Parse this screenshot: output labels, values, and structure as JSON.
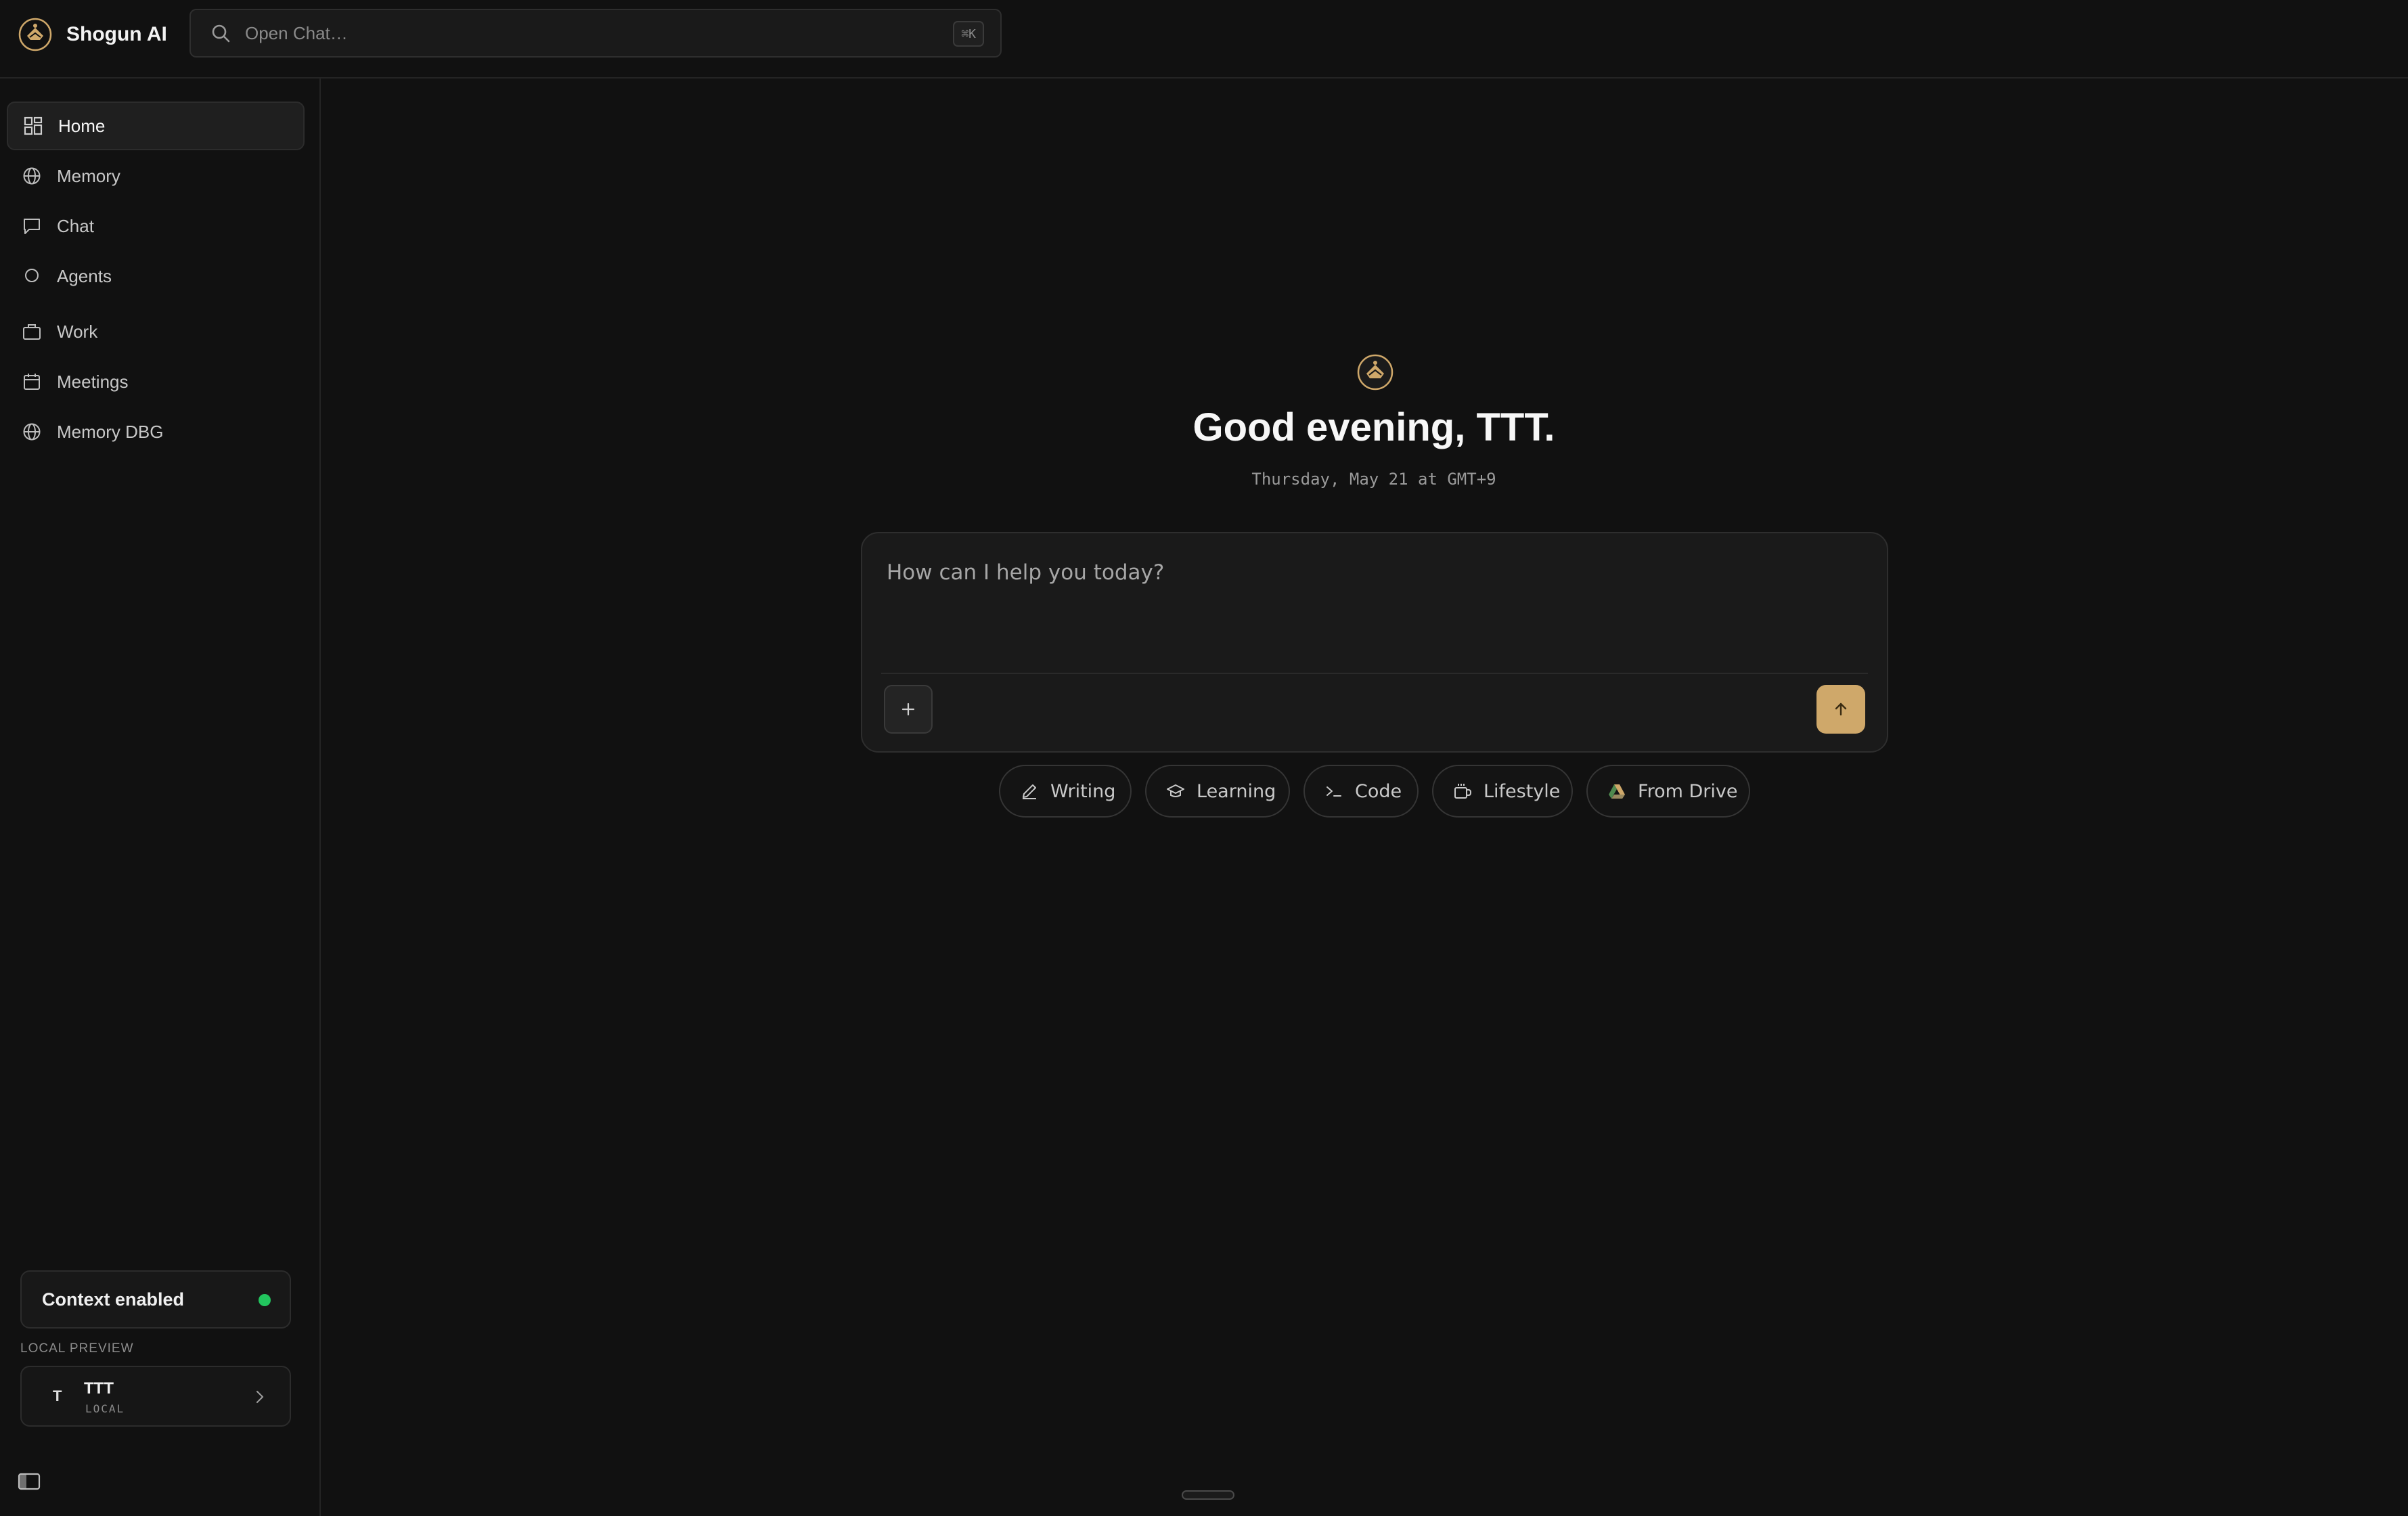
{
  "app": {
    "name": "Shogun AI"
  },
  "search": {
    "placeholder": "Open Chat…",
    "shortcut": "⌘K"
  },
  "sidebar": {
    "items": [
      {
        "label": "Home",
        "icon": "grid-icon",
        "active": true
      },
      {
        "label": "Memory",
        "icon": "globe-icon"
      },
      {
        "label": "Chat",
        "icon": "message-square-icon"
      },
      {
        "label": "Agents",
        "icon": "circle-icon"
      },
      {
        "label": "Work",
        "icon": "briefcase-icon"
      },
      {
        "label": "Meetings",
        "icon": "calendar-icon"
      },
      {
        "label": "Memory DBG",
        "icon": "globe-icon"
      }
    ],
    "context": {
      "label": "Context enabled",
      "status_color": "#22c55e"
    },
    "local_preview_label": "LOCAL PREVIEW",
    "user": {
      "initial": "T",
      "name": "TTT",
      "sub": "LOCAL"
    }
  },
  "main": {
    "greeting": "Good evening, TTT.",
    "date": "Thursday, May 21 at GMT+9",
    "composer": {
      "placeholder": "How can I help you today?"
    },
    "chips": [
      {
        "label": "Writing",
        "icon": "pencil-icon"
      },
      {
        "label": "Learning",
        "icon": "graduation-cap-icon"
      },
      {
        "label": "Code",
        "icon": "terminal-icon"
      },
      {
        "label": "Lifestyle",
        "icon": "coffee-cup-icon"
      },
      {
        "label": "From Drive",
        "icon": "google-drive-icon"
      }
    ]
  },
  "colors": {
    "accent": "#cfa86a",
    "background": "#111111",
    "status_green": "#22c55e"
  }
}
